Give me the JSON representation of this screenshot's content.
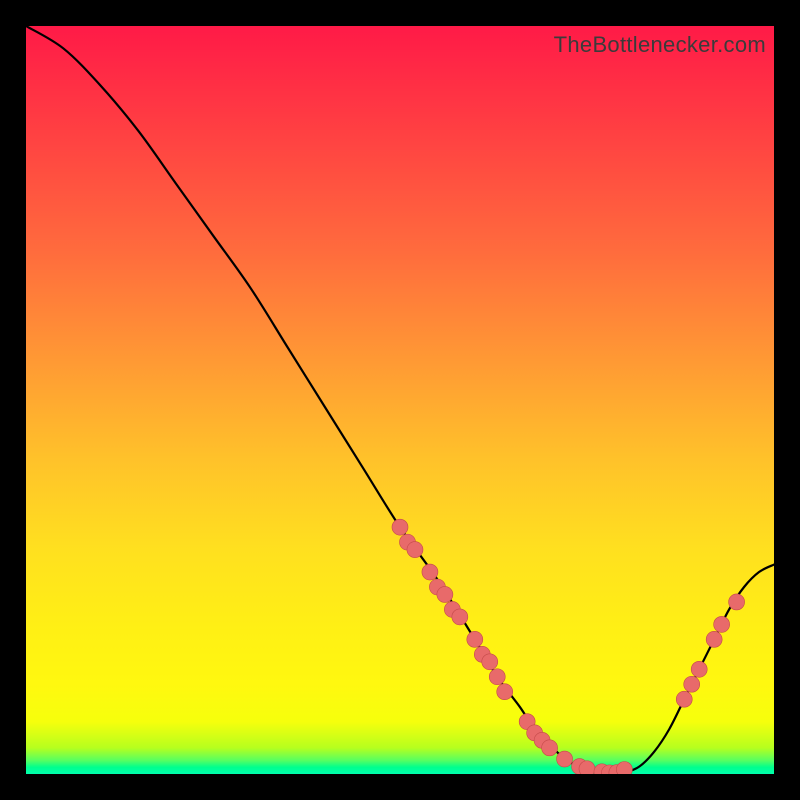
{
  "watermark": "TheBottlenecker.com",
  "colors": {
    "dot_fill": "#e86a6a",
    "dot_stroke": "#c54a4a",
    "curve": "#000000"
  },
  "chart_data": {
    "type": "line",
    "title": "",
    "xlabel": "",
    "ylabel": "",
    "xlim": [
      0,
      100
    ],
    "ylim": [
      0,
      100
    ],
    "curve": {
      "x": [
        0,
        5,
        10,
        15,
        20,
        25,
        30,
        35,
        40,
        45,
        50,
        55,
        60,
        63,
        66,
        68,
        70,
        72,
        74,
        76,
        78,
        80,
        82,
        84,
        86,
        88,
        90,
        92,
        94,
        96,
        98,
        100
      ],
      "y": [
        100,
        97,
        92,
        86,
        79,
        72,
        65,
        57,
        49,
        41,
        33,
        26,
        18,
        13,
        9,
        6,
        4,
        2,
        1,
        0.4,
        0.1,
        0.2,
        1,
        3,
        6,
        10,
        14,
        18,
        22,
        25,
        27,
        28
      ]
    },
    "series": [
      {
        "name": "dots-left-branch",
        "x": [
          50,
          51,
          52,
          54,
          55,
          56,
          57,
          58,
          60,
          61,
          62,
          63,
          64
        ],
        "y": [
          33,
          31,
          30,
          27,
          25,
          24,
          22,
          21,
          18,
          16,
          15,
          13,
          11
        ]
      },
      {
        "name": "dots-valley",
        "x": [
          67,
          68,
          69,
          70,
          72,
          74,
          75,
          77,
          78,
          79,
          80
        ],
        "y": [
          7,
          5.5,
          4.5,
          3.5,
          2,
          1,
          0.7,
          0.3,
          0.15,
          0.2,
          0.6
        ]
      },
      {
        "name": "dots-right-branch",
        "x": [
          88,
          89,
          90,
          92,
          93,
          95
        ],
        "y": [
          10,
          12,
          14,
          18,
          20,
          23
        ]
      }
    ],
    "dot_radius": 8
  }
}
